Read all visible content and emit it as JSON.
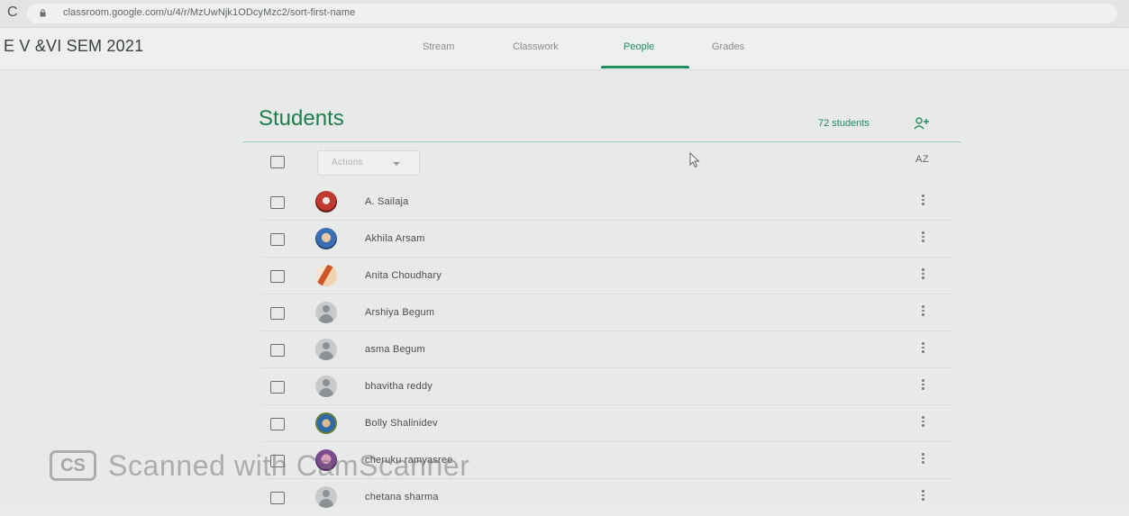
{
  "browser": {
    "url": "classroom.google.com/u/4/r/MzUwNjk1ODcyMzc2/sort-first-name"
  },
  "header": {
    "class_title": "E V &VI SEM 2021",
    "tabs": [
      {
        "label": "Stream",
        "active": false
      },
      {
        "label": "Classwork",
        "active": false
      },
      {
        "label": "People",
        "active": true
      },
      {
        "label": "Grades",
        "active": false
      }
    ]
  },
  "students": {
    "title": "Students",
    "count": "72 students",
    "actions_label": "Actions",
    "sort_label": "AZ",
    "rows": [
      {
        "name": "A. Sailaja",
        "avatar": "photo"
      },
      {
        "name": "Akhila Arsam",
        "avatar": "photo"
      },
      {
        "name": "Anita Choudhary",
        "avatar": "photo"
      },
      {
        "name": "Arshiya Begum",
        "avatar": "default"
      },
      {
        "name": "asma Begum",
        "avatar": "default"
      },
      {
        "name": "bhavitha reddy",
        "avatar": "default"
      },
      {
        "name": "Bolly Shalinidev",
        "avatar": "photo"
      },
      {
        "name": "cheruku ramyasree",
        "avatar": "photo"
      },
      {
        "name": "chetana sharma",
        "avatar": "default"
      }
    ]
  },
  "watermark": {
    "badge": "CS",
    "text": "Scanned with CamScanner"
  },
  "colors": {
    "accent": "#1e8e5e",
    "title_green": "#1e7e4e"
  }
}
